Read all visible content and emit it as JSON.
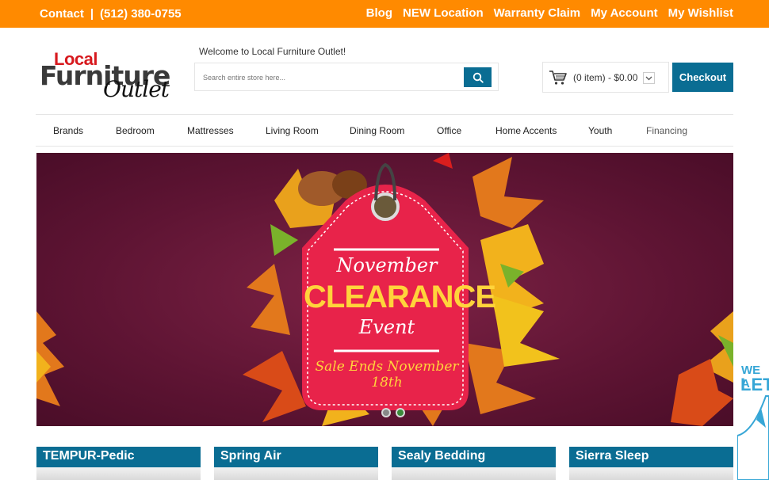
{
  "topbar": {
    "contact": "Contact",
    "sep": "|",
    "phone": "(512) 380-0755",
    "links": [
      "Blog",
      "NEW Location",
      "Warranty Claim",
      "My Account",
      "My Wishlist"
    ]
  },
  "logo": {
    "line1": "Local",
    "line2": "Furniture",
    "line3": "Outlet"
  },
  "header": {
    "welcome": "Welcome to Local Furniture Outlet!",
    "search_placeholder": "Search entire store here...",
    "cart_text": "(0 item) - $0.00",
    "checkout": "Checkout"
  },
  "nav": {
    "items": [
      "Brands",
      "Bedroom",
      "Mattresses",
      "Living Room",
      "Dining Room",
      "Office",
      "Home Accents",
      "Youth",
      "Financing"
    ]
  },
  "banner": {
    "line1": "November",
    "line2": "CLEARANCE",
    "line3": "Event",
    "line4": "Sale Ends November 18th"
  },
  "side_widget": {
    "line1": "WE A",
    "line2": "LET"
  },
  "categories": [
    "TEMPUR-Pedic",
    "Spring Air",
    "Sealy Bedding",
    "Sierra Sleep"
  ],
  "colors": {
    "topbar": "#ff8a00",
    "accent": "#0a6d93",
    "banner_bg": "#6a1a3a",
    "tag": "#e8234a",
    "tag_text_yellow": "#ffd43b"
  }
}
